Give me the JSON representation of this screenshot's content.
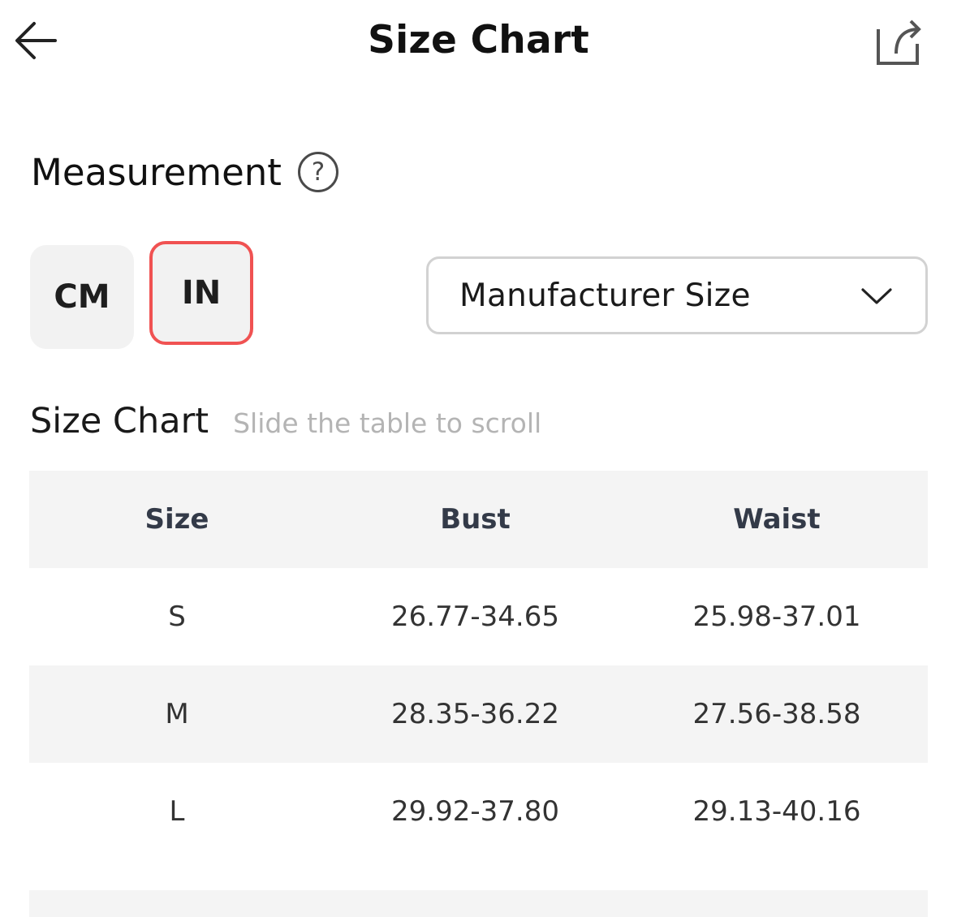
{
  "header": {
    "title": "Size Chart",
    "back_icon": "arrow-left-icon",
    "share_icon": "share-icon"
  },
  "measurement": {
    "title": "Measurement",
    "help_icon_glyph": "?"
  },
  "units": {
    "cm_label": "CM",
    "in_label": "IN",
    "selected": "IN",
    "selected_border_color": "#f05252"
  },
  "size_select": {
    "value": "Manufacturer Size",
    "icon": "chevron-down-icon"
  },
  "size_chart": {
    "title": "Size Chart",
    "hint": "Slide the table to scroll",
    "columns": [
      "Size",
      "Bust",
      "Waist"
    ],
    "rows": [
      {
        "size": "S",
        "bust": "26.77-34.65",
        "waist": "25.98-37.01"
      },
      {
        "size": "M",
        "bust": "28.35-36.22",
        "waist": "27.56-38.58"
      },
      {
        "size": "L",
        "bust": "29.92-37.80",
        "waist": "29.13-40.16"
      }
    ]
  }
}
